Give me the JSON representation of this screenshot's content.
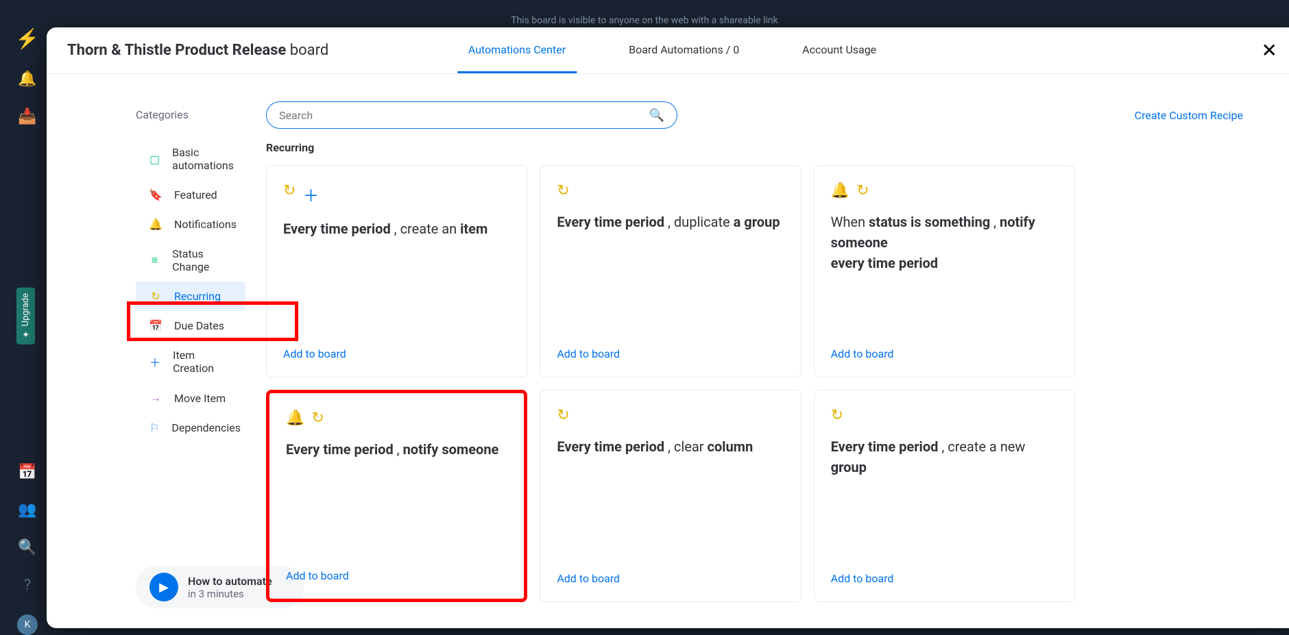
{
  "backdrop_text": "This board is visible to anyone on the web with a shareable link",
  "upgrade_label": "Upgrade",
  "modal": {
    "title_bold": "Thorn & Thistle Product Release",
    "title_thin": " board",
    "tabs": {
      "automations": "Automations Center",
      "board_automations": "Board Automations / 0",
      "account_usage": "Account Usage"
    }
  },
  "categories": {
    "title": "Categories",
    "items": [
      {
        "label": "Basic automations"
      },
      {
        "label": "Featured"
      },
      {
        "label": "Notifications"
      },
      {
        "label": "Status Change"
      },
      {
        "label": "Recurring"
      },
      {
        "label": "Due Dates"
      },
      {
        "label": "Item Creation"
      },
      {
        "label": "Move Item"
      },
      {
        "label": "Dependencies"
      }
    ]
  },
  "howto": {
    "title": "How to automate",
    "sub": "in 3 minutes"
  },
  "search": {
    "placeholder": "Search"
  },
  "create_link": "Create Custom Recipe",
  "section_title": "Recurring",
  "add_label": "Add to board",
  "cards": {
    "c1": {
      "t1": "Every time period",
      "t2": " , create an ",
      "t3": "item"
    },
    "c2": {
      "t1": "Every time period",
      "t2": " , duplicate ",
      "t3": "a group"
    },
    "c3": {
      "t1": "When ",
      "t2": "status",
      "t3": " is ",
      "t4": "something",
      "t5": " , ",
      "t6": "notify someone",
      "t7": "every time period"
    },
    "c4": {
      "t1": "Every time period",
      "t2": " , ",
      "t3": "notify someone"
    },
    "c5": {
      "t1": "Every time period",
      "t2": " , clear ",
      "t3": "column"
    },
    "c6": {
      "t1": "Every time period",
      "t2": " , create a new ",
      "t3": "group"
    }
  }
}
